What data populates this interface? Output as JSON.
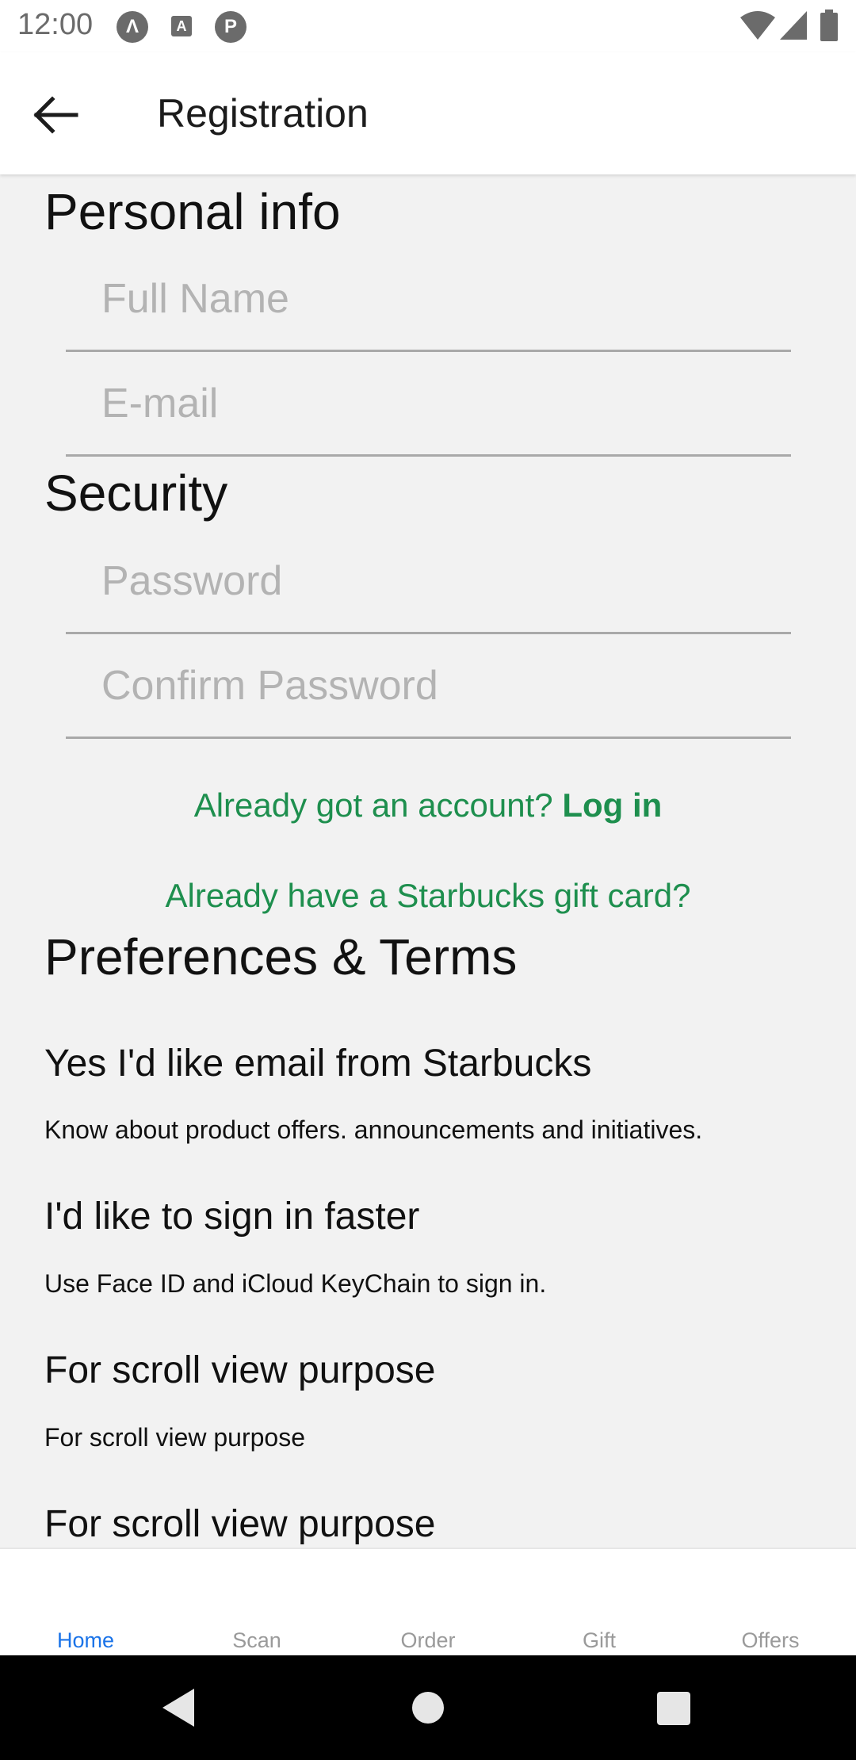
{
  "status_bar": {
    "time": "12:00",
    "icons": [
      "notification-a-icon",
      "notification-box-icon",
      "notification-p-icon",
      "wifi-icon",
      "signal-icon",
      "battery-icon"
    ]
  },
  "app_bar": {
    "title": "Registration",
    "back_icon": "arrow-back-icon"
  },
  "personal_info": {
    "title": "Personal info",
    "full_name_placeholder": "Full Name",
    "email_placeholder": "E-mail"
  },
  "security": {
    "title": "Security",
    "password_placeholder": "Password",
    "confirm_password_placeholder": "Confirm Password"
  },
  "links": {
    "account_prompt": "Already got an account?",
    "login_label": "Log in",
    "gift_card": "Already have a Starbucks gift card?"
  },
  "preferences": {
    "title": "Preferences & Terms",
    "items": [
      {
        "title": "Yes I'd like email from Starbucks",
        "desc": "Know about product offers. announcements and initiatives."
      },
      {
        "title": "I'd like to sign in faster",
        "desc": "Use Face ID and iCloud KeyChain to sign in."
      },
      {
        "title": "For scroll view purpose",
        "desc": "For scroll view purpose"
      },
      {
        "title": "For scroll view purpose",
        "desc": ""
      }
    ]
  },
  "tabs": [
    {
      "label": "Home",
      "active": true
    },
    {
      "label": "Scan",
      "active": false
    },
    {
      "label": "Order",
      "active": false
    },
    {
      "label": "Gift",
      "active": false
    },
    {
      "label": "Offers",
      "active": false
    }
  ],
  "colors": {
    "accent_green": "#1e8f4e",
    "tab_active": "#1a73e8",
    "tab_inactive": "#9a9a9a",
    "background": "#f2f2f2"
  }
}
